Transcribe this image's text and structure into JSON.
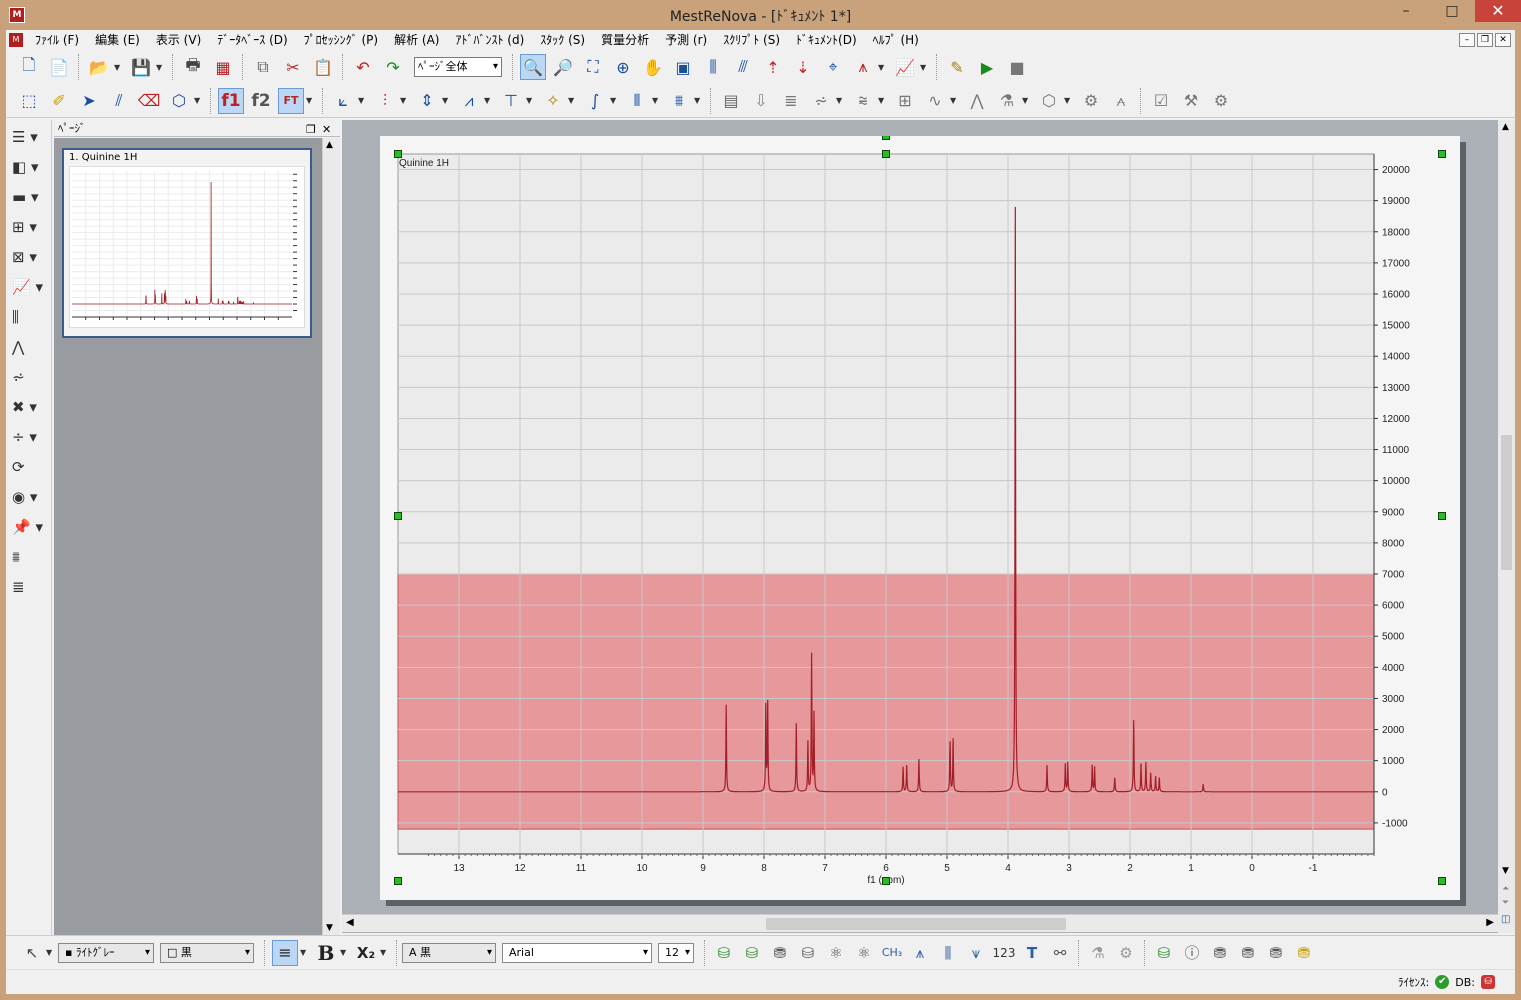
{
  "window": {
    "title": "MestReNova - [ﾄﾞｷｭﾒﾝﾄ 1*]",
    "app_icon_text": "M",
    "buttons": {
      "minimize": "–",
      "maximize": "□",
      "close": "✕"
    }
  },
  "menubar": {
    "items": [
      {
        "label": "ﾌｧｲﾙ (F)"
      },
      {
        "label": "編集 (E)"
      },
      {
        "label": "表示 (V)"
      },
      {
        "label": "ﾃﾞｰﾀﾍﾞｰｽ (D)"
      },
      {
        "label": "ﾌﾟﾛｾｯｼﾝｸﾞ (P)"
      },
      {
        "label": "解析 (A)"
      },
      {
        "label": "ｱﾄﾞﾊﾞﾝｽﾄ (d)"
      },
      {
        "label": "ｽﾀｯｸ (S)"
      },
      {
        "label": "質量分析"
      },
      {
        "label": "予測 (r)"
      },
      {
        "label": "ｽｸﾘﾌﾟﾄ (S)"
      },
      {
        "label": "ﾄﾞｷｭﾒﾝﾄ(D)"
      },
      {
        "label": "ﾍﾙﾌﾟ (H)"
      }
    ],
    "mdi_buttons": [
      "–",
      "❐",
      "✕"
    ]
  },
  "toolbar1": {
    "zoom_select_value": "ﾍﾟｰｼﾞ全体",
    "icons_a": [
      "new-document-icon",
      "new-page-icon",
      "open-folder-icon",
      "save-icon"
    ],
    "icons_b": [
      "print-icon",
      "export-pdf-icon",
      "copy-icon",
      "cut-icon",
      "paste-icon"
    ],
    "icons_c": [
      "zoom-in-icon",
      "zoom-out-icon",
      "full-spectrum-icon",
      "zoom-region-icon",
      "pan-hand-icon",
      "fit-height-icon",
      "peak-height-up-icon",
      "peak-height-down-icon",
      "ylimits-up-icon",
      "ylimits-down-icon",
      "crosshair-icon",
      "peak-pick-icon",
      "plot-axes-icon"
    ],
    "icons_d": [
      "script-edit-icon",
      "run-icon",
      "stop-icon"
    ]
  },
  "toolbar2": {
    "f1_label": "f1",
    "f2_label": "f2",
    "ft_label": "FT"
  },
  "pages_panel": {
    "header": "ﾍﾟｰｼﾞ",
    "thumbnail_label": "1. Quinine 1H"
  },
  "spectrum": {
    "label": "Quinine 1H"
  },
  "chart_data": {
    "type": "line",
    "title": "Quinine 1H",
    "xlabel": "f1 (ppm)",
    "ylabel": "",
    "xlim": [
      14,
      -2
    ],
    "x_reversed": true,
    "ylim": [
      -2000,
      20500
    ],
    "x_ticks": [
      13,
      12,
      11,
      10,
      9,
      8,
      7,
      6,
      5,
      4,
      3,
      2,
      1,
      0,
      -1
    ],
    "y_ticks": [
      20000,
      19000,
      18000,
      17000,
      16000,
      15000,
      14000,
      13000,
      12000,
      11000,
      10000,
      9000,
      8000,
      7000,
      6000,
      5000,
      4000,
      3000,
      2000,
      1000,
      0,
      -1000
    ],
    "grid": true,
    "y_axis_side": "right",
    "highlight_region": {
      "y_from": -1200,
      "y_to": 7000,
      "color": "#e57c80"
    },
    "line_color": "#a01f28",
    "peaks": [
      {
        "ppm": 8.62,
        "height": 2800
      },
      {
        "ppm": 7.97,
        "height": 2750
      },
      {
        "ppm": 7.94,
        "height": 2850
      },
      {
        "ppm": 7.47,
        "height": 2200
      },
      {
        "ppm": 7.28,
        "height": 1600
      },
      {
        "ppm": 7.22,
        "height": 4400
      },
      {
        "ppm": 7.18,
        "height": 2500
      },
      {
        "ppm": 5.72,
        "height": 800
      },
      {
        "ppm": 5.66,
        "height": 850
      },
      {
        "ppm": 5.46,
        "height": 1050
      },
      {
        "ppm": 4.95,
        "height": 1600
      },
      {
        "ppm": 4.9,
        "height": 1700
      },
      {
        "ppm": 3.88,
        "height": 18800
      },
      {
        "ppm": 3.36,
        "height": 850
      },
      {
        "ppm": 3.06,
        "height": 900
      },
      {
        "ppm": 3.02,
        "height": 950
      },
      {
        "ppm": 2.62,
        "height": 850
      },
      {
        "ppm": 2.58,
        "height": 800
      },
      {
        "ppm": 2.25,
        "height": 450
      },
      {
        "ppm": 1.94,
        "height": 2300
      },
      {
        "ppm": 1.82,
        "height": 900
      },
      {
        "ppm": 1.74,
        "height": 950
      },
      {
        "ppm": 1.66,
        "height": 600
      },
      {
        "ppm": 1.58,
        "height": 500
      },
      {
        "ppm": 1.52,
        "height": 450
      },
      {
        "ppm": 0.8,
        "height": 250
      }
    ]
  },
  "bottom_toolbar": {
    "fill_color_value": "ﾗｲﾄｸﾞﾚｰ",
    "line_color_value": "黒",
    "text_color_value": "黒",
    "font_value": "Arial",
    "font_size_value": "12",
    "bold_label": "B",
    "subscript_label": "X₂"
  },
  "statusbar": {
    "license_label": "ﾗｲｾﾝｽ:",
    "db_label": "DB:"
  }
}
